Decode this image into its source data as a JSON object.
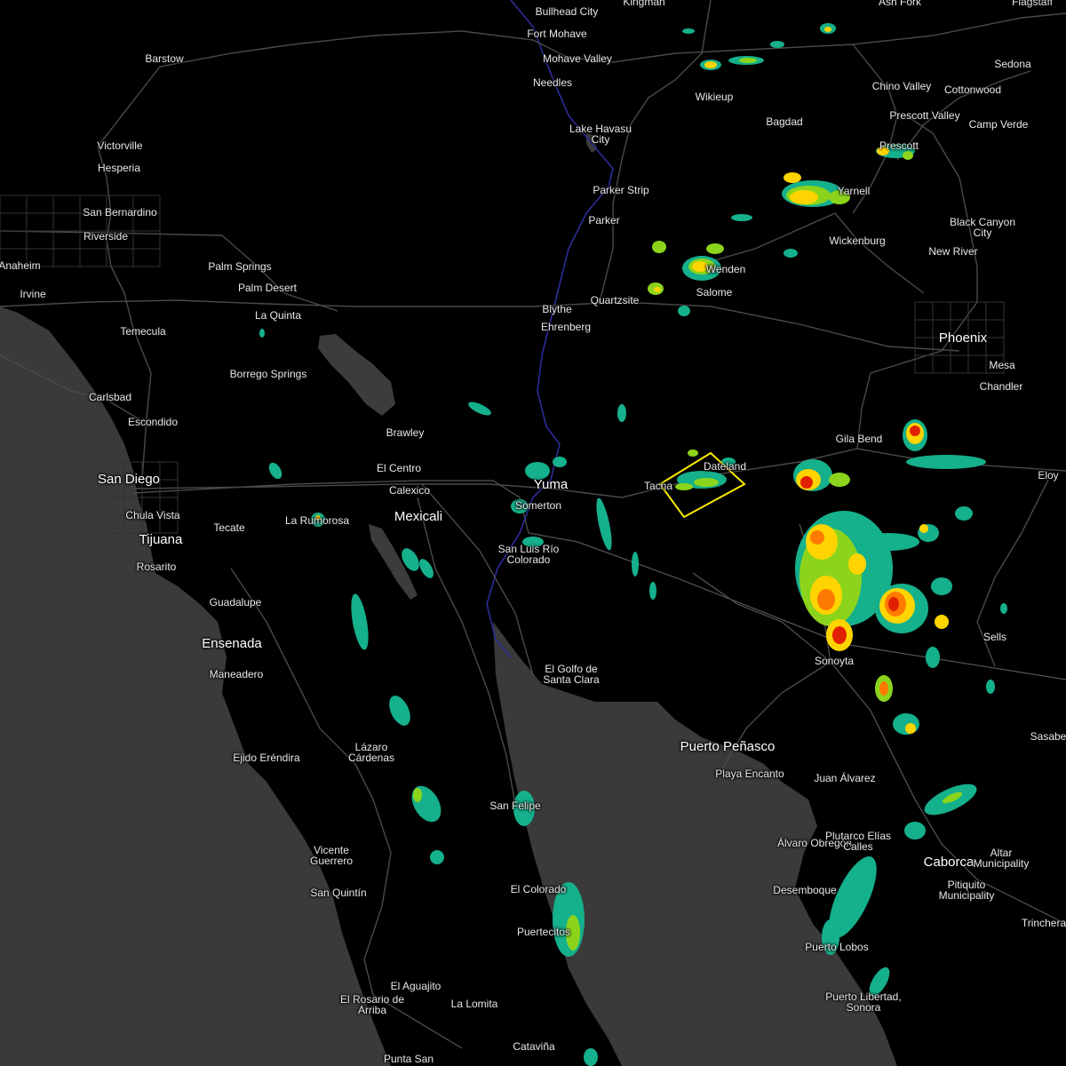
{
  "map": {
    "colors": {
      "land": "#000000",
      "water": "#3a3a3a",
      "lake": "#3c3c3c",
      "roads": "#4a4a4a",
      "borders": "#555555",
      "river": "#2c2c9a",
      "warning_polygon": "#ffea00",
      "radar_light": "#15b08c",
      "radar_moderate": "#8cd41c",
      "radar_heavy": "#ffd400",
      "radar_intense": "#ff7a00",
      "radar_severe": "#e02000"
    },
    "places": [
      {
        "name": "Bullhead City",
        "big": false
      },
      {
        "name": "Kingman",
        "big": false
      },
      {
        "name": "Ash Fork",
        "big": false
      },
      {
        "name": "Flagstaff",
        "big": false
      },
      {
        "name": "Fort Mohave",
        "big": false
      },
      {
        "name": "Mohave Valley",
        "big": false
      },
      {
        "name": "Barstow",
        "big": false
      },
      {
        "name": "Needles",
        "big": false
      },
      {
        "name": "Sedona",
        "big": false
      },
      {
        "name": "Chino Valley",
        "big": false
      },
      {
        "name": "Cottonwood",
        "big": false
      },
      {
        "name": "Wikieup",
        "big": false
      },
      {
        "name": "Prescott Valley",
        "big": false
      },
      {
        "name": "Bagdad",
        "big": false
      },
      {
        "name": "Camp Verde",
        "big": false
      },
      {
        "name": "Victorville",
        "big": false
      },
      {
        "name": "Lake Havasu City",
        "big": false
      },
      {
        "name": "Prescott",
        "big": false
      },
      {
        "name": "Hesperia",
        "big": false
      },
      {
        "name": "Parker Strip",
        "big": false
      },
      {
        "name": "Yarnell",
        "big": false
      },
      {
        "name": "San Bernardino",
        "big": false
      },
      {
        "name": "Parker",
        "big": false
      },
      {
        "name": "Black Canyon City",
        "big": false
      },
      {
        "name": "Riverside",
        "big": false
      },
      {
        "name": "Wickenburg",
        "big": false
      },
      {
        "name": "New River",
        "big": false
      },
      {
        "name": "Anaheim",
        "big": false
      },
      {
        "name": "Palm Springs",
        "big": false
      },
      {
        "name": "Wenden",
        "big": false
      },
      {
        "name": "Salome",
        "big": false
      },
      {
        "name": "Palm Desert",
        "big": false
      },
      {
        "name": "Irvine",
        "big": false
      },
      {
        "name": "Quartzsite",
        "big": false
      },
      {
        "name": "La Quinta",
        "big": false
      },
      {
        "name": "Blythe",
        "big": false
      },
      {
        "name": "Ehrenberg",
        "big": false
      },
      {
        "name": "Temecula",
        "big": false
      },
      {
        "name": "Phoenix",
        "big": true
      },
      {
        "name": "Mesa",
        "big": false
      },
      {
        "name": "Borrego Springs",
        "big": false
      },
      {
        "name": "Chandler",
        "big": false
      },
      {
        "name": "Carlsbad",
        "big": false
      },
      {
        "name": "Escondido",
        "big": false
      },
      {
        "name": "Brawley",
        "big": false
      },
      {
        "name": "Gila Bend",
        "big": false
      },
      {
        "name": "Dateland",
        "big": false
      },
      {
        "name": "El Centro",
        "big": false
      },
      {
        "name": "San Diego",
        "big": true
      },
      {
        "name": "Eloy",
        "big": false
      },
      {
        "name": "Yuma",
        "big": true
      },
      {
        "name": "Tacna",
        "big": false
      },
      {
        "name": "Calexico",
        "big": false
      },
      {
        "name": "Chula Vista",
        "big": false
      },
      {
        "name": "Somerton",
        "big": false
      },
      {
        "name": "Mexicali",
        "big": true
      },
      {
        "name": "La Rumorosa",
        "big": false
      },
      {
        "name": "Tecate",
        "big": false
      },
      {
        "name": "Tijuana",
        "big": true
      },
      {
        "name": "San Luis Río Colorado",
        "big": false
      },
      {
        "name": "Rosarito",
        "big": false
      },
      {
        "name": "Guadalupe",
        "big": false
      },
      {
        "name": "Sells",
        "big": false
      },
      {
        "name": "Ensenada",
        "big": true
      },
      {
        "name": "Sonoyta",
        "big": false
      },
      {
        "name": "Maneadero",
        "big": false
      },
      {
        "name": "El Golfo de Santa Clara",
        "big": false
      },
      {
        "name": "Sasabe",
        "big": false
      },
      {
        "name": "Puerto Peñasco",
        "big": true
      },
      {
        "name": "Lázaro Cárdenas",
        "big": false
      },
      {
        "name": "Ejido Eréndira",
        "big": false
      },
      {
        "name": "Playa Encanto",
        "big": false
      },
      {
        "name": "Juan Álvarez",
        "big": false
      },
      {
        "name": "San Felipe",
        "big": false
      },
      {
        "name": "Álvaro Obregón",
        "big": false
      },
      {
        "name": "Plutarco Elías Calles",
        "big": false
      },
      {
        "name": "Vicente Guerrero",
        "big": false
      },
      {
        "name": "Caborca",
        "big": true
      },
      {
        "name": "Altar Municipality",
        "big": false
      },
      {
        "name": "El Colorado",
        "big": false
      },
      {
        "name": "San Quintín",
        "big": false
      },
      {
        "name": "Desemboque",
        "big": false
      },
      {
        "name": "Pitiquito Municipality",
        "big": false
      },
      {
        "name": "Trincheras",
        "big": false
      },
      {
        "name": "Puertecitos",
        "big": false
      },
      {
        "name": "Puerto Lobos",
        "big": false
      },
      {
        "name": "El Aguajito",
        "big": false
      },
      {
        "name": "El Rosario de Arriba",
        "big": false
      },
      {
        "name": "La Lomita",
        "big": false
      },
      {
        "name": "Puerto Libertad, Sonora",
        "big": false
      },
      {
        "name": "Cataviña",
        "big": false
      },
      {
        "name": "Punta San",
        "big": false
      }
    ]
  }
}
